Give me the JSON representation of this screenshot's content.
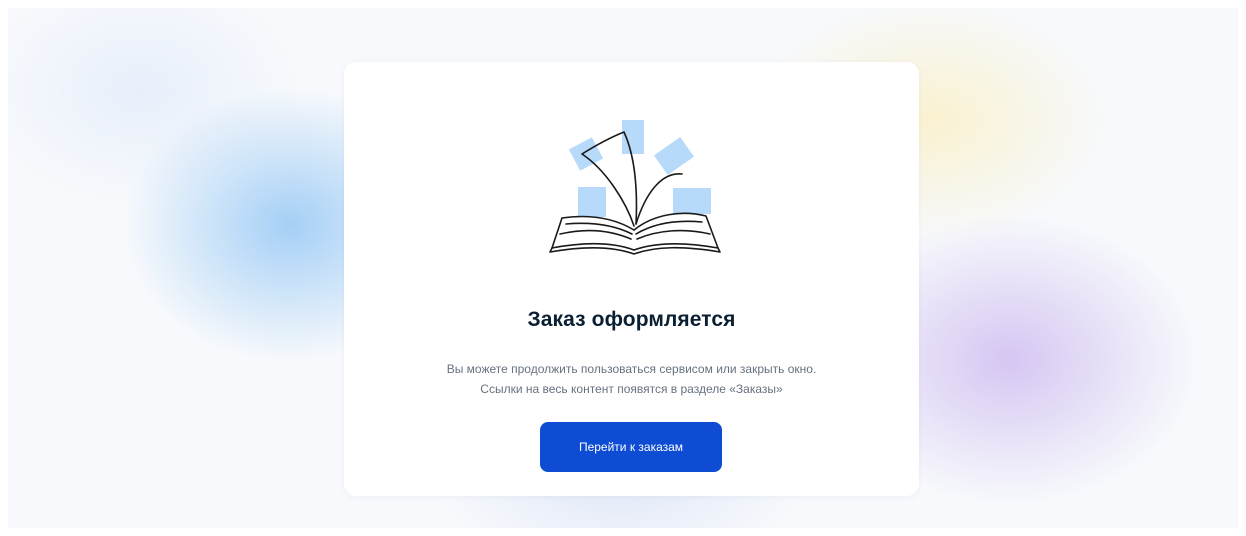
{
  "dialog": {
    "illustration": "open-book-with-pages-icon",
    "title": "Заказ оформляется",
    "description_line1": "Вы можете продолжить пользоваться сервисом или закрыть окно.",
    "description_line2": "Ссылки на весь контент появятся в разделе «Заказы»",
    "button_label": "Перейти к заказам"
  },
  "colors": {
    "accent": "#0d4cd3",
    "title": "#0b1f33",
    "text_secondary": "#66727f",
    "page_blue_tint": "#a5cdf3",
    "illustration_page": "#b7dafa"
  }
}
